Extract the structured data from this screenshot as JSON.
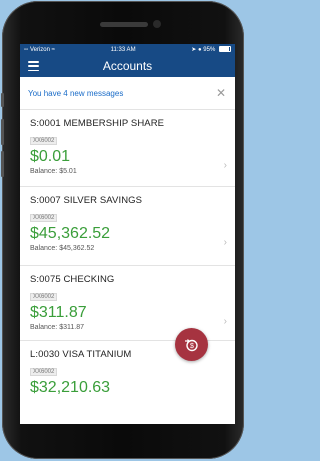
{
  "status_bar": {
    "carrier": "Verizon",
    "time": "11:33 AM",
    "battery": "95%"
  },
  "nav": {
    "title": "Accounts",
    "menu_icon": "hamburger-menu-icon"
  },
  "messages": {
    "text": "You have 4 new messages",
    "dismiss_icon": "close-icon"
  },
  "accounts": [
    {
      "name": "S:0001 MEMBERSHIP SHARE",
      "mask": "XX6002",
      "amount": "$0.01",
      "balance_label": "Balance:",
      "balance_value": "$5.01"
    },
    {
      "name": "S:0007 SILVER SAVINGS",
      "mask": "XX6002",
      "amount": "$45,362.52",
      "balance_label": "Balance:",
      "balance_value": "$45,362.52"
    },
    {
      "name": "S:0075 CHECKING",
      "mask": "XX6002",
      "amount": "$311.87",
      "balance_label": "Balance:",
      "balance_value": "$311.87"
    },
    {
      "name": "L:0030 VISA TITANIUM",
      "mask": "XX6002",
      "amount": "$32,210.63"
    }
  ],
  "colors": {
    "header": "#174a85",
    "amount": "#3a9e3a",
    "message_link": "#1a6cc8",
    "fab": "#a63340",
    "background": "#9dc6e6"
  },
  "fab": {
    "icon": "transfer-money-icon"
  }
}
